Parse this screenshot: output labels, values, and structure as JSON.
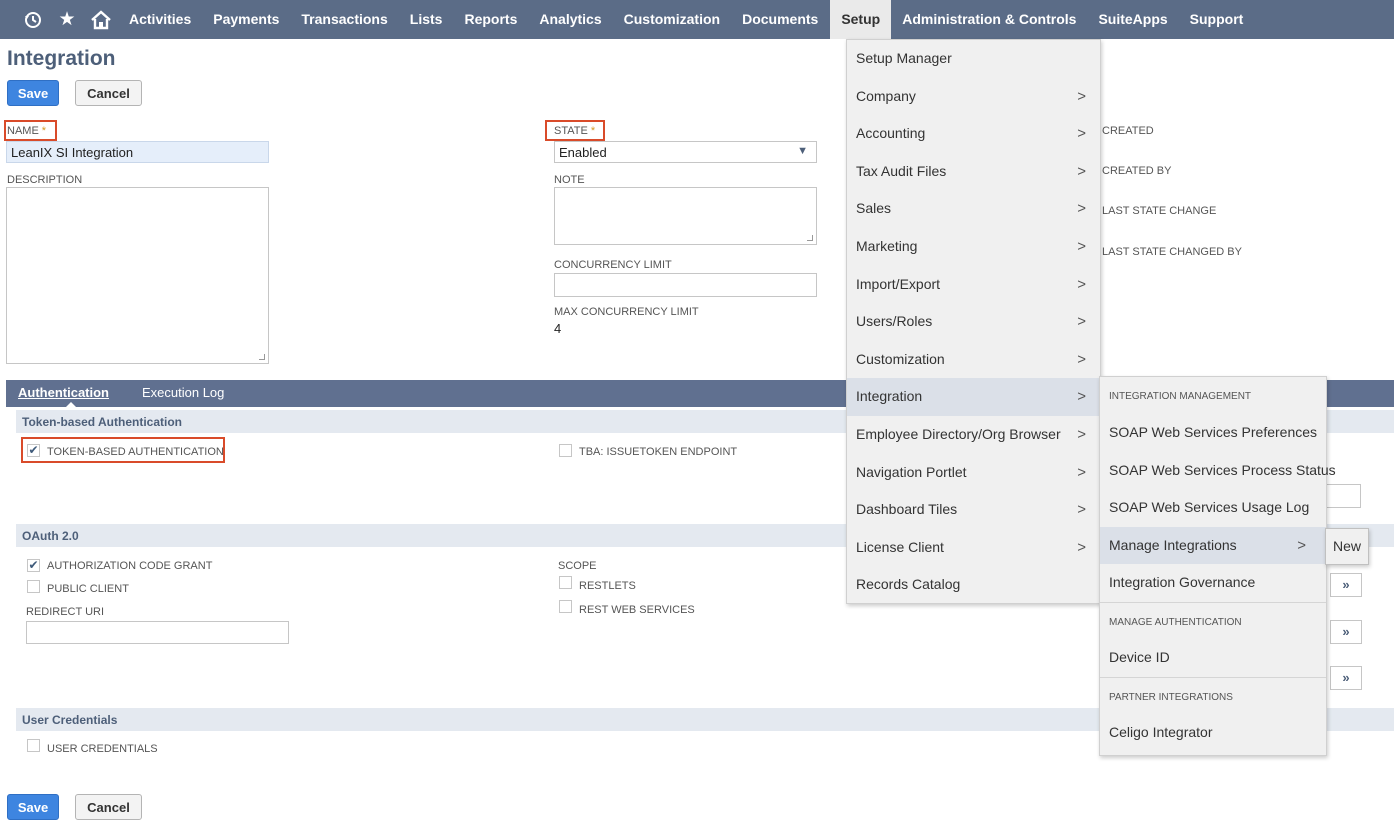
{
  "nav": {
    "icons": [
      "recent-icon",
      "star-icon",
      "home-icon"
    ],
    "items": [
      "Activities",
      "Payments",
      "Transactions",
      "Lists",
      "Reports",
      "Analytics",
      "Customization",
      "Documents",
      "Setup",
      "Administration & Controls",
      "SuiteApps",
      "Support"
    ],
    "active": "Setup"
  },
  "page": {
    "title": "Integration",
    "save_label": "Save",
    "cancel_label": "Cancel"
  },
  "form": {
    "name_label": "NAME",
    "name_value": "LeanIX SI Integration",
    "description_label": "DESCRIPTION",
    "state_label": "STATE",
    "state_value": "Enabled",
    "note_label": "NOTE",
    "concurrency_label": "CONCURRENCY LIMIT",
    "max_concurrency_label": "MAX CONCURRENCY LIMIT",
    "max_concurrency_value": "4",
    "created_label": "CREATED",
    "created_by_label": "CREATED BY",
    "last_state_change_label": "LAST STATE CHANGE",
    "last_state_changed_by_label": "LAST STATE CHANGED BY",
    "required_mark": "*"
  },
  "tabs": {
    "authentication": "Authentication",
    "execution_log": "Execution Log"
  },
  "sections": {
    "tba_header": "Token-based Authentication",
    "tba_label": "TOKEN-BASED AUTHENTICATION",
    "tba_issuetoken_label": "TBA: ISSUETOKEN ENDPOINT",
    "oauth_header": "OAuth 2.0",
    "auth_code_grant_label": "AUTHORIZATION CODE GRANT",
    "public_client_label": "PUBLIC CLIENT",
    "redirect_uri_label": "REDIRECT URI",
    "scope_label": "SCOPE",
    "restlets_label": "RESTLETS",
    "rest_web_services_label": "REST WEB SERVICES",
    "user_credentials_header": "User Credentials",
    "user_credentials_label": "USER CREDENTIALS"
  },
  "setup_menu": {
    "items": [
      {
        "label": "Setup Manager",
        "arrow": false
      },
      {
        "label": "Company",
        "arrow": true
      },
      {
        "label": "Accounting",
        "arrow": true
      },
      {
        "label": "Tax Audit Files",
        "arrow": true
      },
      {
        "label": "Sales",
        "arrow": true
      },
      {
        "label": "Marketing",
        "arrow": true
      },
      {
        "label": "Import/Export",
        "arrow": true
      },
      {
        "label": "Users/Roles",
        "arrow": true
      },
      {
        "label": "Customization",
        "arrow": true
      },
      {
        "label": "Integration",
        "arrow": true
      },
      {
        "label": "Employee Directory/Org Browser",
        "arrow": true
      },
      {
        "label": "Navigation Portlet",
        "arrow": true
      },
      {
        "label": "Dashboard Tiles",
        "arrow": true
      },
      {
        "label": "License Client",
        "arrow": true
      },
      {
        "label": "Records Catalog",
        "arrow": false
      }
    ],
    "arrow_glyph": ">"
  },
  "integration_menu": {
    "integration_management_header": "INTEGRATION MANAGEMENT",
    "soap_prefs": "SOAP Web Services Preferences",
    "soap_process_status": "SOAP Web Services Process Status",
    "soap_usage_log": "SOAP Web Services Usage Log",
    "manage_integrations": "Manage Integrations",
    "integration_governance": "Integration Governance",
    "manage_authentication_header": "MANAGE AUTHENTICATION",
    "device_id": "Device ID",
    "partner_integrations_header": "PARTNER INTEGRATIONS",
    "celigo": "Celigo Integrator"
  },
  "manage_integrations_menu": {
    "new": "New"
  }
}
